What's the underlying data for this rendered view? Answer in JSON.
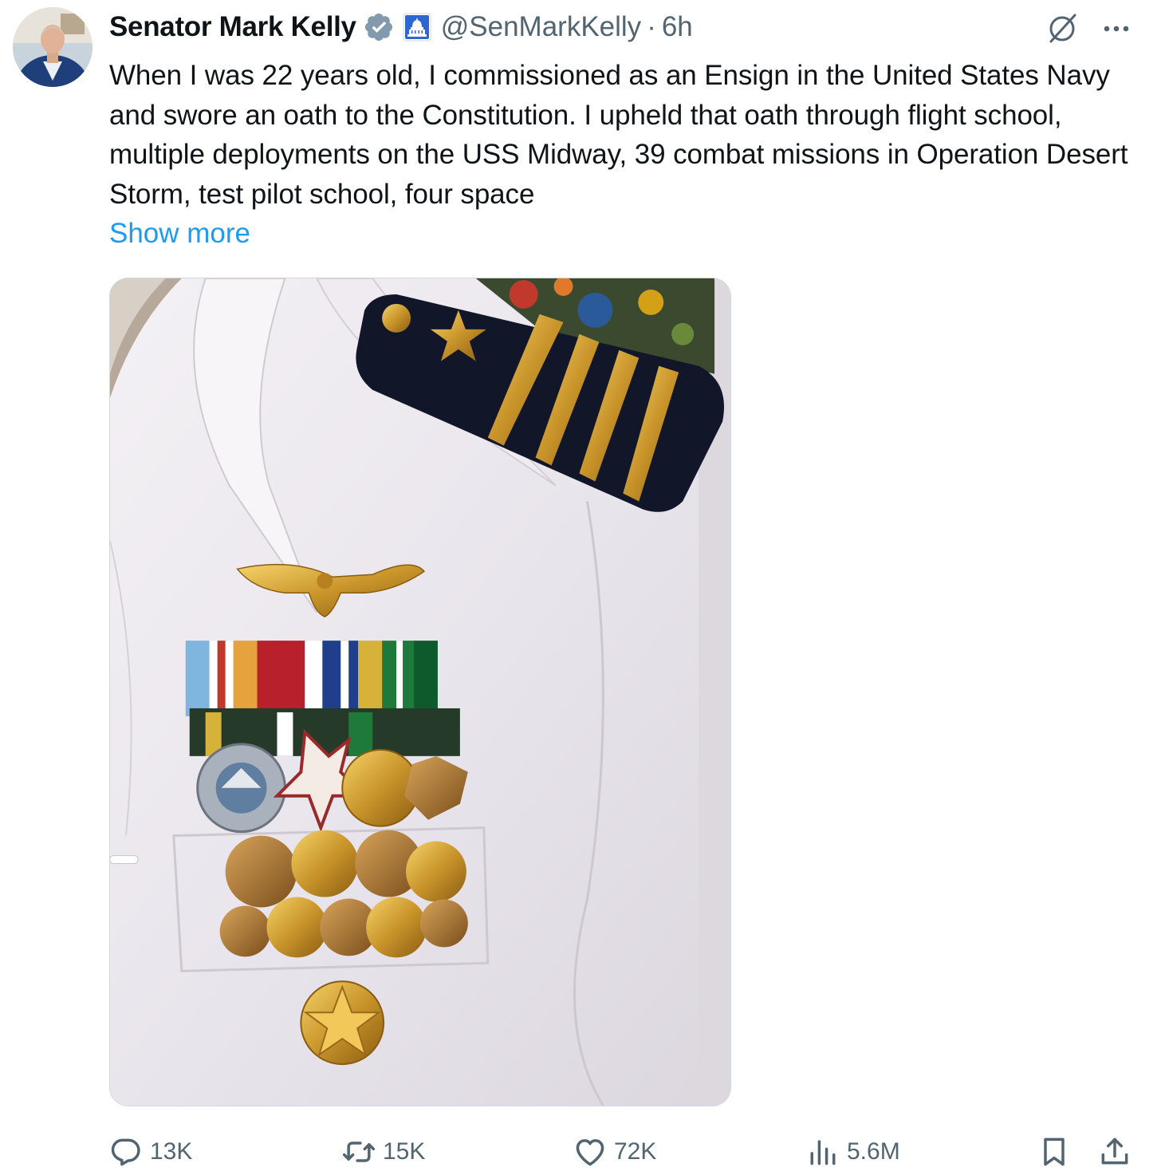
{
  "author": {
    "display_name": "Senator Mark Kelly",
    "handle": "@SenMarkKelly",
    "separator": "·",
    "time": "6h",
    "verified_icon": "verified-badge-icon",
    "affiliation_icon": "us-capitol-icon"
  },
  "tweet": {
    "text": "When I was 22 years old, I commissioned as an Ensign in the United States Navy and swore an oath to the Constitution. I upheld that oath through flight school, multiple deployments on the USS Midway, 39 combat missions in Operation Desert Storm, test pilot school, four space",
    "show_more": "Show more"
  },
  "actions": {
    "replies": "13K",
    "reposts": "15K",
    "likes": "72K",
    "views": "5.6M"
  },
  "colors": {
    "text": "#0f1419",
    "secondary": "#536471",
    "link": "#1d9bf0",
    "verified": "#829aab"
  }
}
